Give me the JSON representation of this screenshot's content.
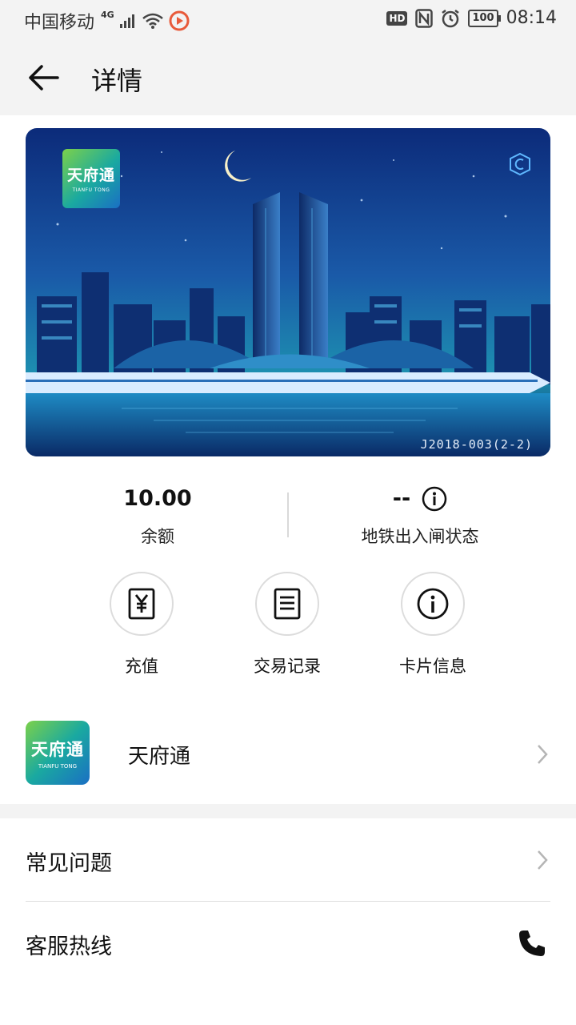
{
  "status_bar": {
    "carrier": "中国移动",
    "network": "4G",
    "hd": "HD",
    "battery": "100",
    "time": "08:14"
  },
  "header": {
    "title": "详情"
  },
  "card": {
    "logo_cn": "天府通",
    "logo_en": "TIANFU TONG",
    "code": "J2018-003(2-2)"
  },
  "stats": {
    "balance_value": "10.00",
    "balance_label": "余额",
    "gate_value": "--",
    "gate_label": "地铁出入闸状态"
  },
  "actions": [
    {
      "label": "充值",
      "icon": "yen-receipt-icon"
    },
    {
      "label": "交易记录",
      "icon": "document-icon"
    },
    {
      "label": "卡片信息",
      "icon": "info-icon"
    }
  ],
  "app": {
    "name": "天府通",
    "icon_cn": "天府通",
    "icon_en": "TIANFU TONG"
  },
  "list": {
    "faq": "常见问题",
    "hotline": "客服热线"
  },
  "colors": {
    "background": "#ffffff",
    "band": "#f3f3f3",
    "text": "#111111",
    "brand_green": "#7cd14a",
    "brand_blue": "#1a6fc4"
  }
}
